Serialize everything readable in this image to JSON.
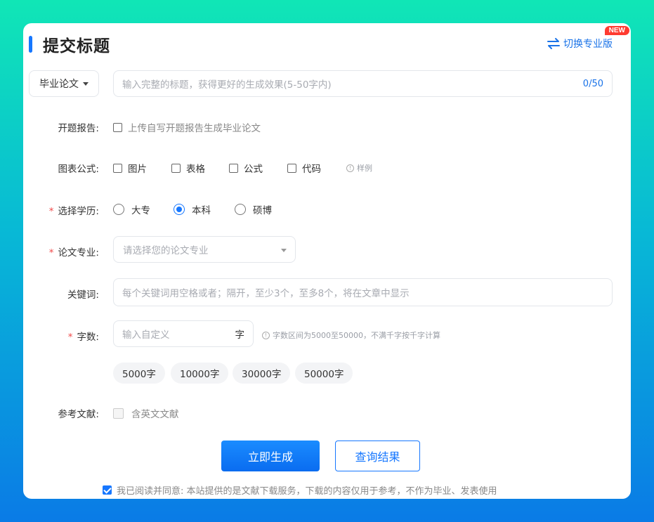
{
  "header": {
    "title": "提交标题",
    "switch_label": "切换专业版",
    "new_badge": "NEW",
    "accent_color": "#1677ff"
  },
  "title_row": {
    "type_select_value": "毕业论文",
    "title_placeholder": "输入完整的标题，获得更好的生成效果(5-50字内)",
    "counter": "0/50"
  },
  "proposal": {
    "label": "开题报告:",
    "option": "上传自写开题报告生成毕业论文"
  },
  "charts": {
    "label": "图表公式:",
    "options": [
      "图片",
      "表格",
      "公式",
      "代码"
    ],
    "example": "样例"
  },
  "education": {
    "required": "*",
    "label": "选择学历:",
    "options": [
      "大专",
      "本科",
      "硕博"
    ],
    "selected": "本科"
  },
  "major": {
    "required": "*",
    "label": "论文专业:",
    "placeholder": "请选择您的论文专业"
  },
  "keywords": {
    "label": "关键词:",
    "placeholder": "每个关键词用空格或者；隔开，至少3个，至多8个，将在文章中显示"
  },
  "word_count": {
    "required": "*",
    "label": "字数:",
    "placeholder": "输入自定义",
    "suffix": "字",
    "hint": "字数区间为5000至50000，不满千字按千字计算",
    "presets": [
      "5000字",
      "10000字",
      "30000字",
      "50000字"
    ]
  },
  "references": {
    "label": "参考文献:",
    "option": "含英文文献"
  },
  "actions": {
    "generate": "立即生成",
    "query": "查询结果"
  },
  "agreement": {
    "text": "我已阅读并同意: 本站提供的是文献下载服务，下载的内容仅用于参考，不作为毕业、发表使用",
    "checked": true
  }
}
